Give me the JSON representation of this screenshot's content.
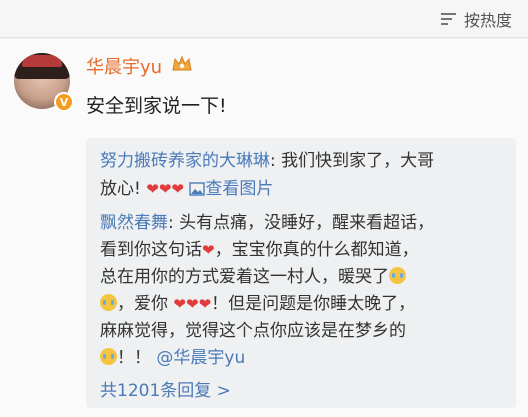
{
  "toolbar": {
    "sort_label": "按热度"
  },
  "post": {
    "username": "华晨宇yu",
    "text": "安全到家说一下!"
  },
  "replies": [
    {
      "name": "努力搬砖养家的大琳琳",
      "line1": ": 我们快到家了，大哥",
      "line2_text": "放心!",
      "view_pic": "查看图片"
    },
    {
      "name": "飘然春舞",
      "line1": ": 头有点痛，没睡好，醒来看超话，",
      "line2_a": "看到你这句话",
      "line2_b": "，宝宝你真的什么都知道，",
      "line3": "总在用你的方式爱着这一村人，暖哭了",
      "line4_a": "，爱你",
      "line4_b": "！但是问题是你睡太晚了，",
      "line5": "麻麻觉得，觉得这个点你应该是在梦乡的",
      "line6_a": "！！",
      "mention": "@华晨宇yu"
    }
  ],
  "more_replies": "共1201条回复 >",
  "colors": {
    "username": "#e86a2c",
    "link": "#4b7ab8",
    "heart": "#e23b3b",
    "reply_bg": "#eef0f2"
  }
}
